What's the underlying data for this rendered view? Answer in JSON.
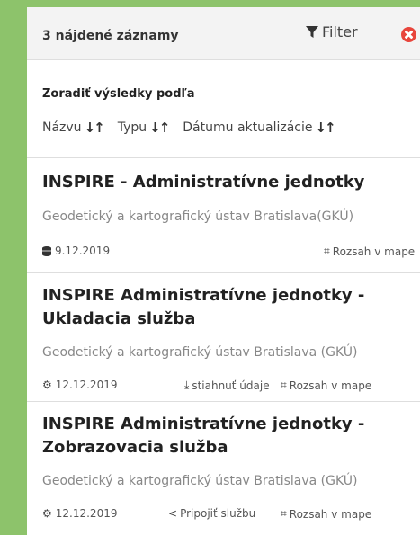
{
  "header": {
    "count": "3 nájdené záznamy",
    "filter_label": "Filter"
  },
  "sort": {
    "title": "Zoradiť výsledky podľa",
    "options": [
      "Názvu",
      "Typu",
      "Dátumu aktualizácie"
    ]
  },
  "records": [
    {
      "title": "INSPIRE - Administratívne jednotky",
      "org": "Geodetický a kartografický ústav Bratislava(GKÚ)",
      "date": "9.12.2019",
      "type_icon": "database-icon",
      "actions": [
        "Rozsah v mape"
      ]
    },
    {
      "title": "INSPIRE Administratívne jednotky - Ukladacia služba",
      "org": "Geodetický a kartografický ústav Bratislava (GKÚ)",
      "date": "12.12.2019",
      "type_icon": "gear-icon",
      "actions": [
        "stiahnuť údaje",
        "Rozsah v mape"
      ]
    },
    {
      "title": "INSPIRE Administratívne jednotky - Zobrazovacia služba",
      "org": "Geodetický a kartografický ústav Bratislava (GKÚ)",
      "date": "12.12.2019",
      "type_icon": "gear-icon",
      "actions": [
        "Pripojiť službu",
        "Rozsah v mape"
      ]
    }
  ],
  "colors": {
    "background": "#8dc36b",
    "close": "#e8453c"
  }
}
